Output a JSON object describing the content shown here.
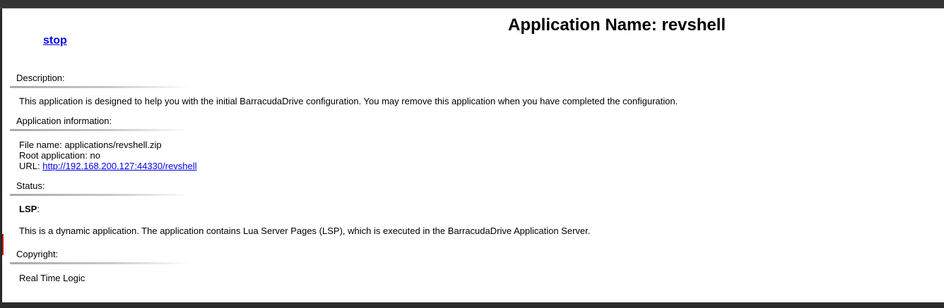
{
  "header": {
    "title": "Application Name: revshell",
    "stop_link": "stop"
  },
  "description": {
    "heading": "Description:",
    "text": "This application is designed to help you with the initial BarracudaDrive configuration. You may remove this application when you have completed the configuration."
  },
  "app_info": {
    "heading": "Application information:",
    "file_name_label": "File name:",
    "file_name": "applications/revshell.zip",
    "root_label": "Root application:",
    "root_value": "no",
    "url_label": "URL:",
    "url": "http://192.168.200.127:44330/revshell"
  },
  "status": {
    "heading": "Status:",
    "lsp_label": "LSP",
    "lsp_suffix": ":",
    "text": "This is a dynamic application. The application contains Lua Server Pages (LSP), which is executed in the BarracudaDrive Application Server."
  },
  "copyright": {
    "heading": "Copyright:",
    "text": "Real Time Logic"
  }
}
